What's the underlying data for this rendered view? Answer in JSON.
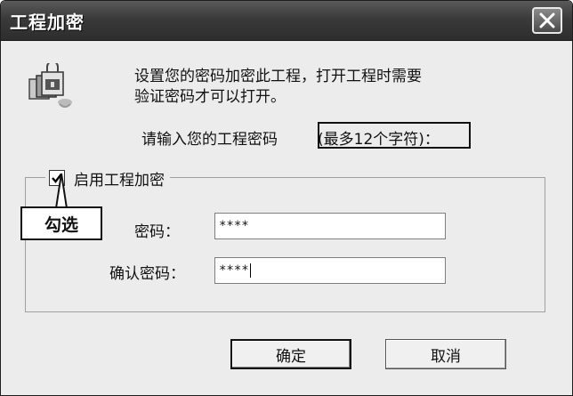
{
  "window": {
    "title": "工程加密",
    "close_icon": "close-icon"
  },
  "content": {
    "app_icon": "project-lock-icon",
    "description_line1": "设置您的密码加密此工程，打开工程时需要",
    "description_line2": "验证密码才可以打开。",
    "prompt_text": "请输入您的工程密码",
    "prompt_highlight": "(最多12个字符)："
  },
  "encryption_group": {
    "checkbox_label": "启用工程加密",
    "checked": true,
    "annotation": "勾选",
    "password_label": "密码：",
    "password_value": "****",
    "confirm_label": "确认密码：",
    "confirm_value": "****"
  },
  "buttons": {
    "ok_label": "确定",
    "cancel_label": "取消"
  }
}
